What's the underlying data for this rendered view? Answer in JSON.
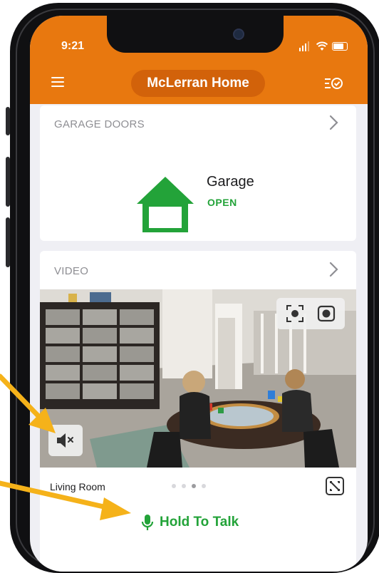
{
  "status_bar": {
    "time": "9:21"
  },
  "header": {
    "title": "McLerran Home"
  },
  "garage_card": {
    "title": "GARAGE DOORS",
    "device_name": "Garage",
    "device_status": "OPEN",
    "status_color": "#23a339"
  },
  "video_card": {
    "title": "VIDEO",
    "camera_name": "Living Room",
    "page_dots": {
      "count": 4,
      "active_index": 2
    },
    "talk_label": "Hold To Talk"
  },
  "colors": {
    "accent": "#e8780f",
    "accent_dark": "#d2620a",
    "success_green": "#23a339",
    "annotation_arrow": "#f5b21a"
  },
  "icons": [
    "menu-icon",
    "scenes-icon",
    "chevron-right-icon",
    "garage-icon",
    "snapshot-icon",
    "record-icon",
    "mute-icon",
    "expand-icon",
    "microphone-icon"
  ]
}
